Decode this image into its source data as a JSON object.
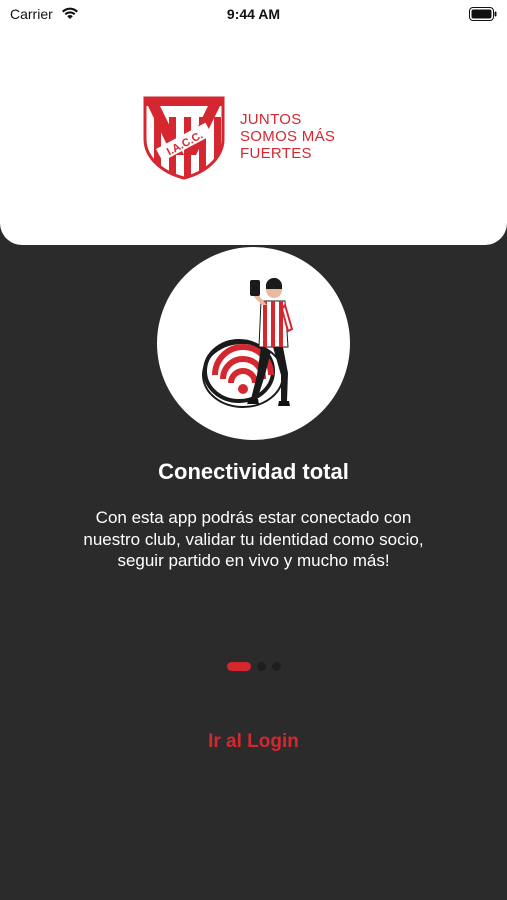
{
  "status_bar": {
    "carrier": "Carrier",
    "time": "9:44 AM",
    "icons": [
      "wifi-icon",
      "battery-icon"
    ]
  },
  "header": {
    "logo": {
      "emblem_text": "I.A.C.C.",
      "slogan_lines": [
        "JUNTOS",
        "SOMOS MÁS",
        "FUERTES"
      ]
    }
  },
  "onboarding": {
    "illustration": "person-on-wifi-signal-illustration",
    "title": "Conectividad total",
    "description": "Con esta app podrás estar conectado con nuestro club, validar tu identidad como socio, seguir partido en vivo y mucho más!",
    "pager": {
      "total": 3,
      "active_index": 0
    }
  },
  "actions": {
    "login_label": "Ir al Login"
  },
  "colors": {
    "accent": "#d42730",
    "background": "#2b2b2b",
    "card": "#ffffff"
  }
}
